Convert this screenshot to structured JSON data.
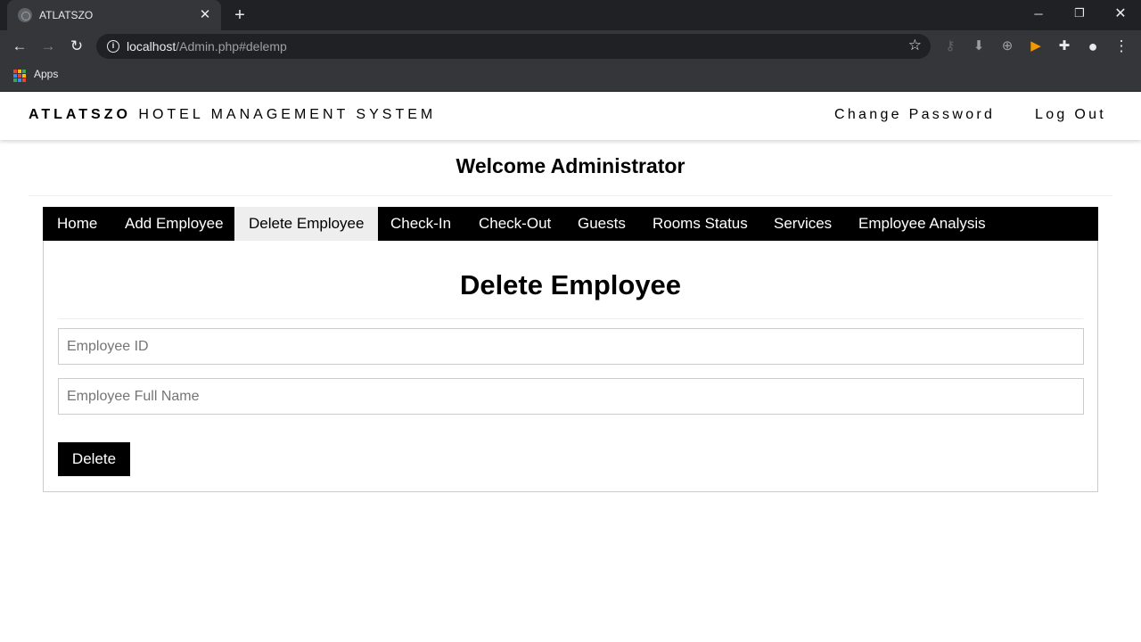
{
  "browser": {
    "tab_title": "ATLATSZO",
    "url_host": "localhost",
    "url_path": "/Admin.php#delemp",
    "bookmarks": [
      {
        "label": "Apps"
      }
    ]
  },
  "header": {
    "brand_bold": "ATLATSZO",
    "brand_rest": "HOTEL MANAGEMENT SYSTEM",
    "links": [
      "Change Password",
      "Log Out"
    ]
  },
  "welcome": "Welcome Administrator",
  "nav_tabs": [
    {
      "label": "Home",
      "active": false
    },
    {
      "label": "Add Employee",
      "active": false
    },
    {
      "label": "Delete Employee",
      "active": true
    },
    {
      "label": "Check-In",
      "active": false
    },
    {
      "label": "Check-Out",
      "active": false
    },
    {
      "label": "Guests",
      "active": false
    },
    {
      "label": "Rooms Status",
      "active": false
    },
    {
      "label": "Services",
      "active": false
    },
    {
      "label": "Employee Analysis",
      "active": false
    }
  ],
  "form": {
    "title": "Delete Employee",
    "employee_id": {
      "value": "",
      "placeholder": "Employee ID"
    },
    "employee_name": {
      "value": "",
      "placeholder": "Employee Full Name"
    },
    "submit_label": "Delete"
  }
}
